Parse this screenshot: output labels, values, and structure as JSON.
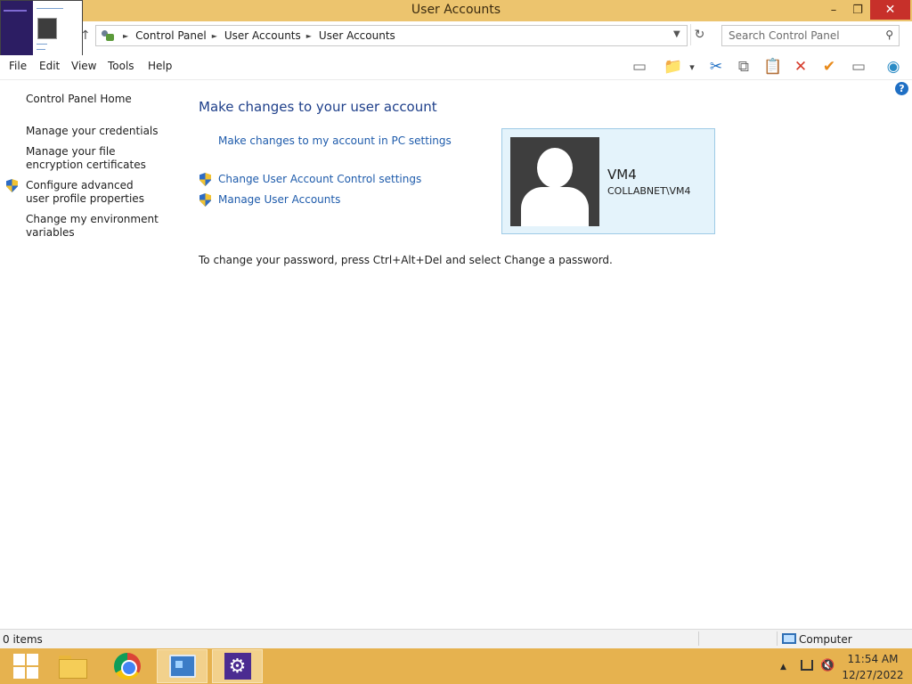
{
  "window": {
    "title": "User Accounts",
    "minimize": "–",
    "maximize": "❐",
    "close": "✕"
  },
  "address_bar": {
    "crumbs": [
      "Control Panel",
      "User Accounts",
      "User Accounts"
    ],
    "separator": "►",
    "dropdown": "▼",
    "refresh": "↻",
    "up": "↑"
  },
  "search": {
    "placeholder": "Search Control Panel",
    "icon": "⚲"
  },
  "menu": {
    "items": [
      "File",
      "Edit",
      "View",
      "Tools",
      "Help"
    ]
  },
  "toolbar": {
    "icons": [
      "layout-pane-icon",
      "folder-check-icon",
      "dropdown-arrow-icon",
      "cut-icon",
      "copy-icon",
      "paste-icon",
      "delete-icon",
      "checkmark-icon",
      "properties-icon",
      "globe-icon"
    ],
    "glyphs": [
      "▭",
      "📁",
      "▾",
      "✂",
      "⧉",
      "📋",
      "✕",
      "✔",
      "▭",
      "◉"
    ],
    "colors": [
      "#6d6d6d",
      "#d9a62b",
      "#444444",
      "#1f6fc4",
      "#6d6d6d",
      "#8b6b2e",
      "#d63a2a",
      "#e88a1a",
      "#6d6d6d",
      "#2a8bc5"
    ],
    "help": "?"
  },
  "left_nav": {
    "home": "Control Panel Home",
    "items": [
      "Manage your credentials",
      "Manage your file encryption certificates",
      "Configure advanced user profile properties",
      "Change my environment variables"
    ]
  },
  "main": {
    "heading": "Make changes to your user account",
    "pc_settings_link": "Make changes to my account in PC settings",
    "uac_link": "Change User Account Control settings",
    "manage_link": "Manage User Accounts",
    "password_note": "To change your password, press Ctrl+Alt+Del and select Change a password."
  },
  "user_card": {
    "name": "VM4",
    "domain": "COLLABNET\\VM4"
  },
  "status_bar": {
    "items": "0 items",
    "location": "Computer"
  },
  "taskbar": {
    "apps": [
      "start-button",
      "file-explorer",
      "chrome",
      "control-panel",
      "settings"
    ],
    "gear": "⚙",
    "tray_arrow": "▲",
    "volume": "🔇",
    "time": "11:54 AM",
    "date": "12/27/2022"
  },
  "colors": {
    "titlebar": "#ecc46e",
    "taskbar": "#e6b24f",
    "link": "#1e5bab",
    "heading": "#1e3f8a",
    "close": "#c7302a"
  }
}
